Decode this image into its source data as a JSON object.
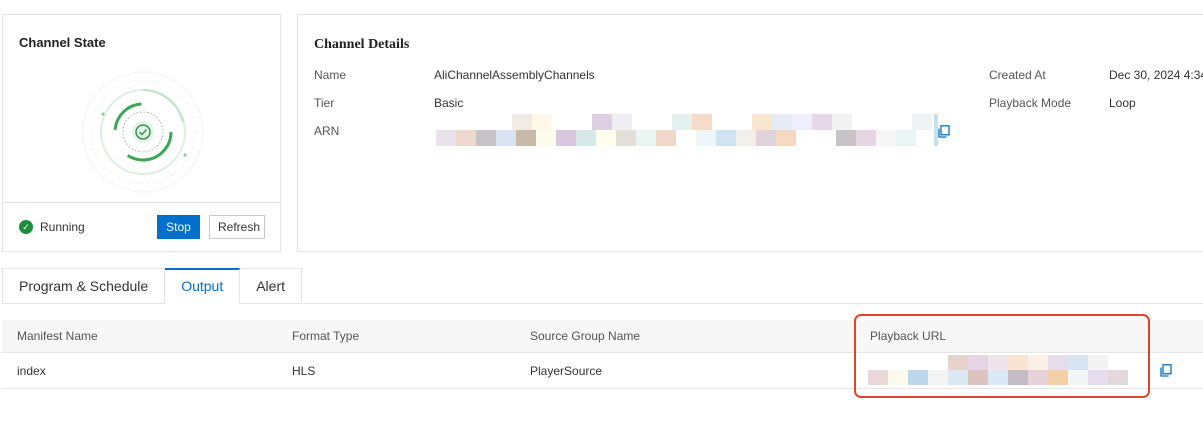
{
  "channel_state": {
    "title": "Channel State",
    "status_text": "Running",
    "stop_label": "Stop",
    "refresh_label": "Refresh",
    "status_color": "#1e8e3e"
  },
  "channel_details": {
    "title": "Channel Details",
    "name_label": "Name",
    "name_value": "AliChannelAssemblyChannels",
    "tier_label": "Tier",
    "tier_value": "Basic",
    "arn_label": "ARN",
    "created_label": "Created At",
    "created_value": "Dec 30, 2024 4:34",
    "playback_mode_label": "Playback Mode",
    "playback_mode_value": "Loop"
  },
  "tabs": [
    {
      "label": "Program & Schedule",
      "active": false
    },
    {
      "label": "Output",
      "active": true
    },
    {
      "label": "Alert",
      "active": false
    }
  ],
  "output_table": {
    "columns": [
      "Manifest Name",
      "Format Type",
      "Source Group Name",
      "Playback URL"
    ],
    "rows": [
      {
        "manifest": "index",
        "format": "HLS",
        "source_group": "PlayerSource"
      }
    ]
  },
  "colors": {
    "accent": "#0070cc",
    "highlight": "#e0452b"
  }
}
